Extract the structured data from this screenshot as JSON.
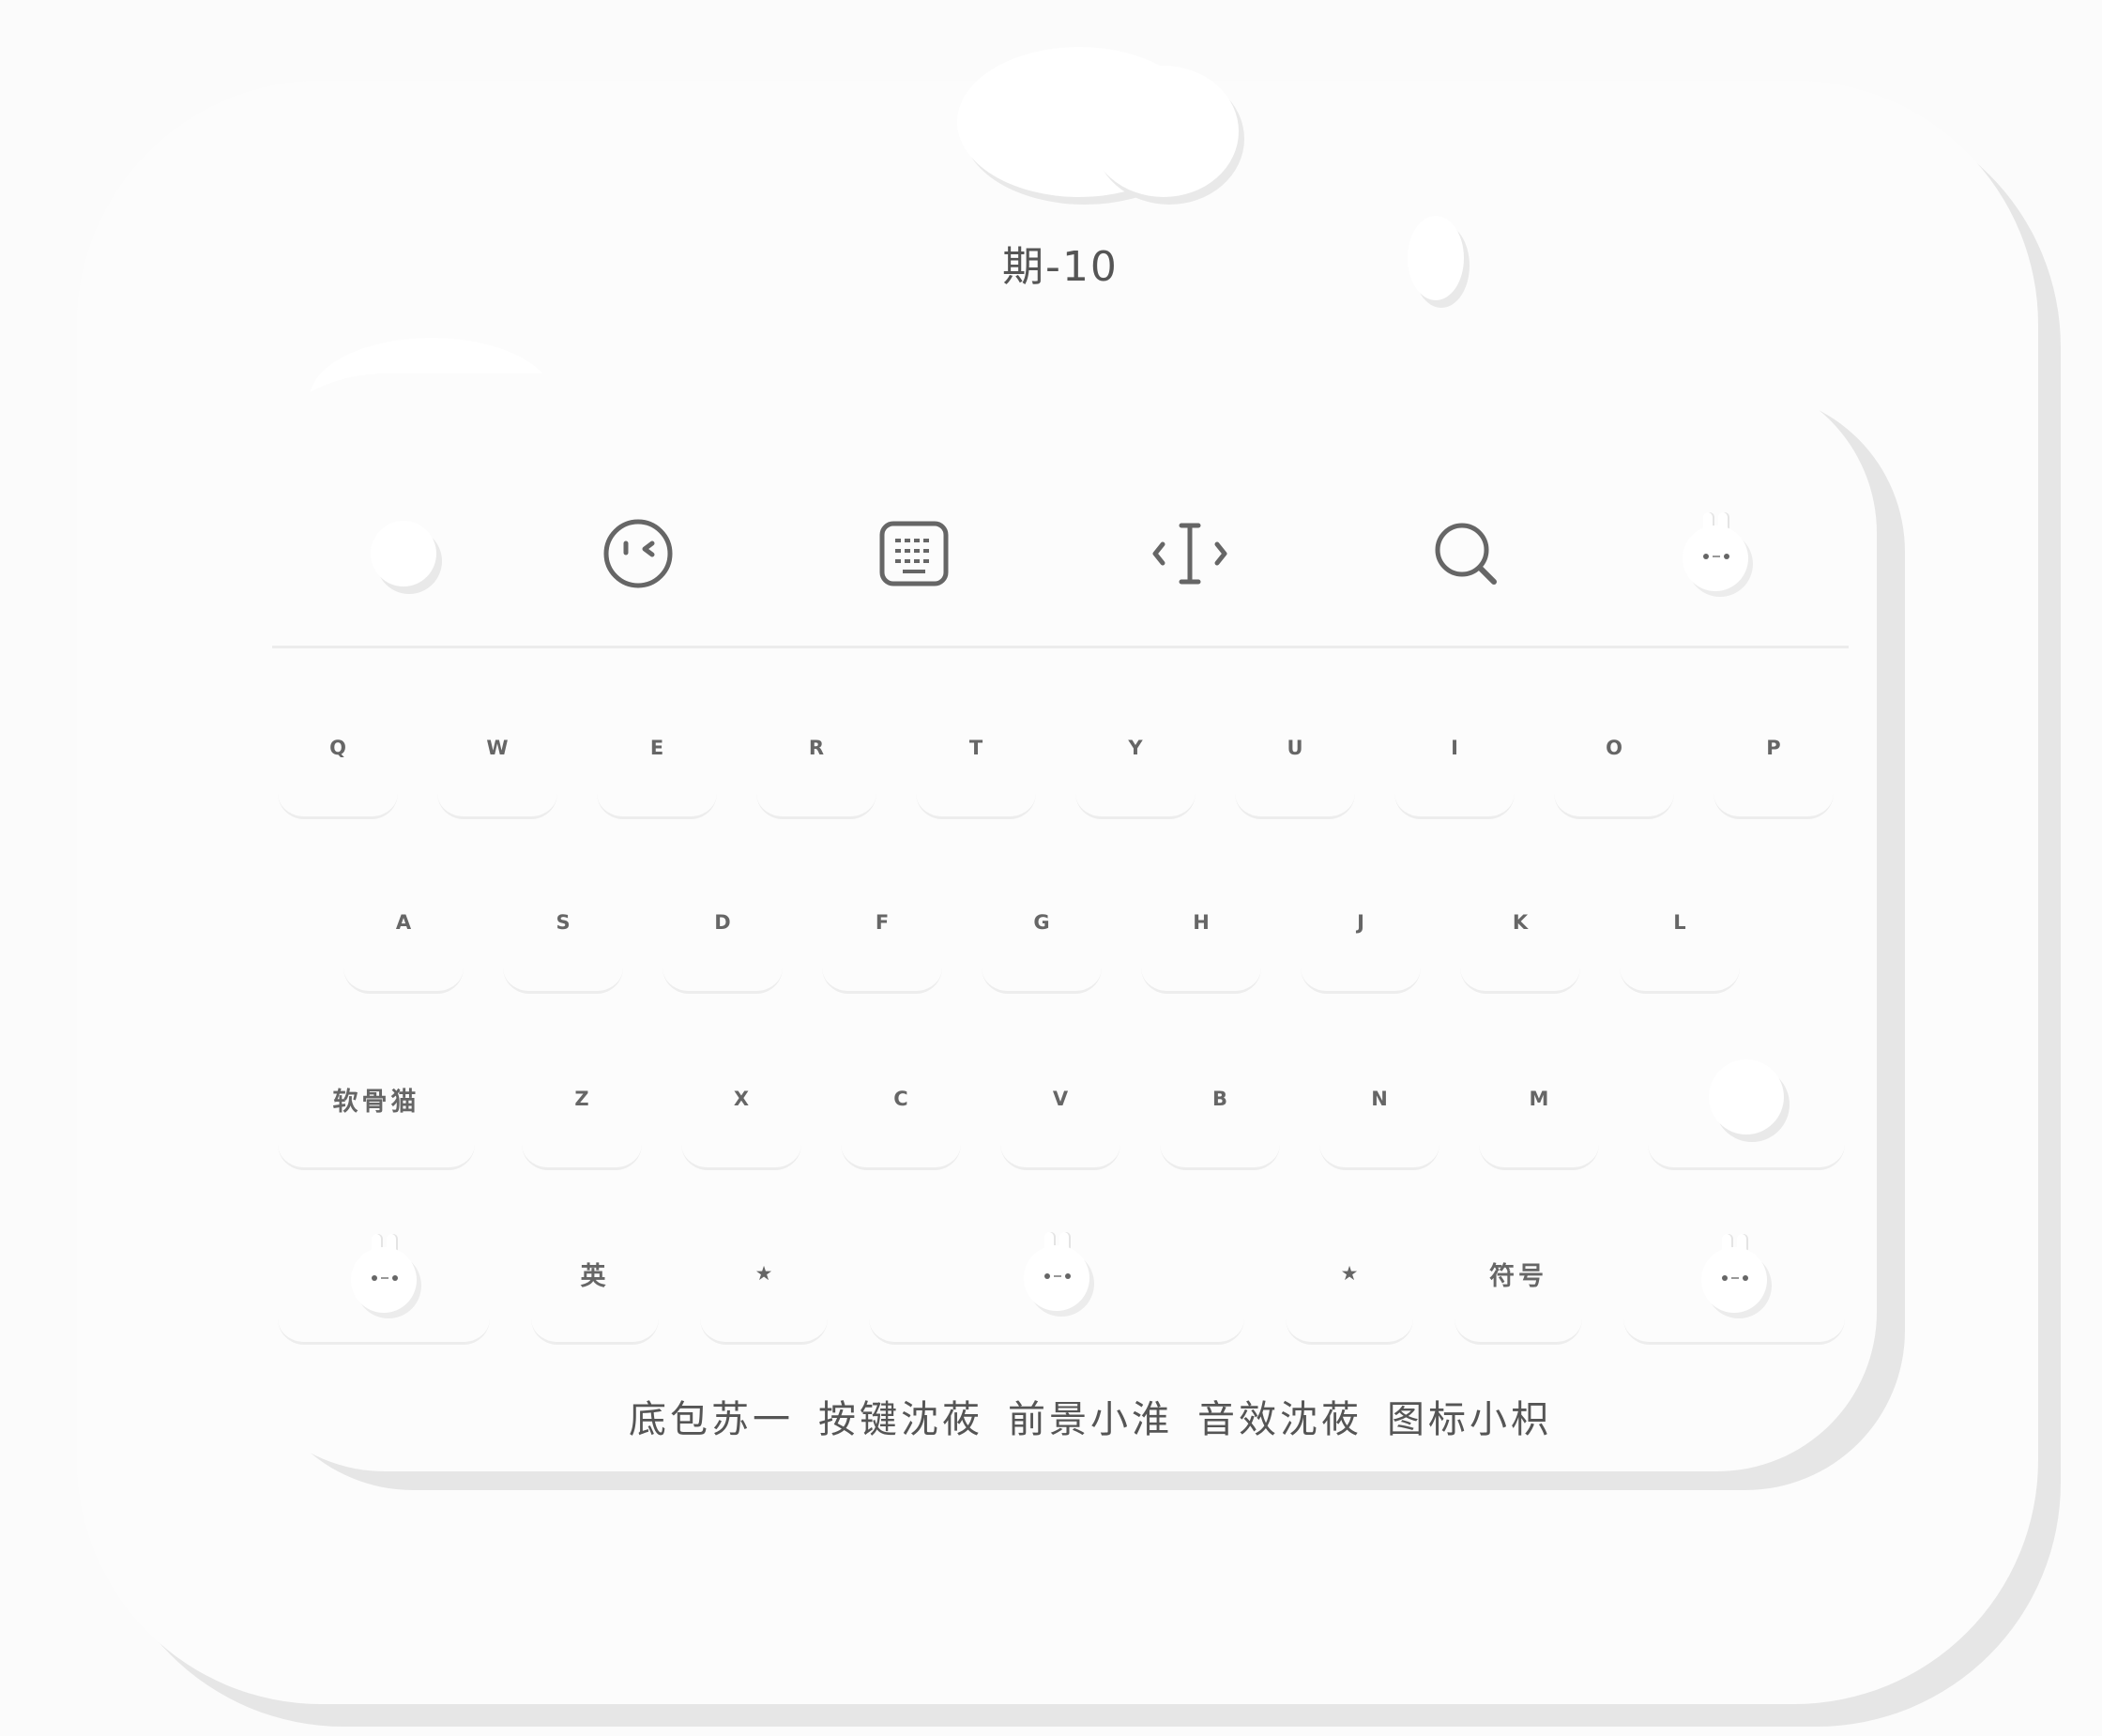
{
  "title": "期-10",
  "toolbar": {
    "items": [
      {
        "name": "cloud-icon"
      },
      {
        "name": "emoji-face-icon"
      },
      {
        "name": "keyboard-icon"
      },
      {
        "name": "text-cursor-icon"
      },
      {
        "name": "search-icon"
      },
      {
        "name": "bunny-icon"
      }
    ]
  },
  "rows": {
    "row1": [
      "Q",
      "W",
      "E",
      "R",
      "T",
      "Y",
      "U",
      "I",
      "O",
      "P"
    ],
    "row2": [
      "A",
      "S",
      "D",
      "F",
      "G",
      "H",
      "J",
      "K",
      "L"
    ],
    "row3": [
      "Z",
      "X",
      "C",
      "V",
      "B",
      "N",
      "M"
    ],
    "row3_left": "软骨猫",
    "row4": {
      "lang": "英",
      "star_left": "★",
      "star_right": "★",
      "symbols": "符号"
    }
  },
  "footer": {
    "items": [
      "底包苏一",
      "按键沈莜",
      "前景小淮",
      "音效沈莜",
      "图标小枳"
    ]
  }
}
